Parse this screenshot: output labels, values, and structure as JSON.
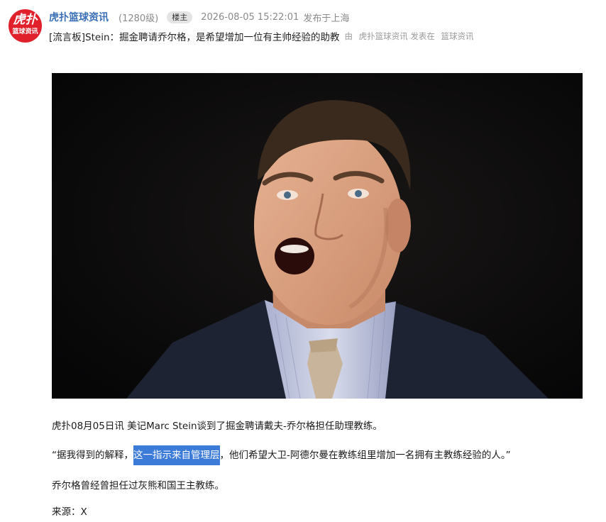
{
  "post": {
    "avatar_line1": "虎扑",
    "avatar_line2": "篮球资讯",
    "author": "虎扑篮球资讯",
    "level": "(1280级)",
    "badge": "楼主",
    "time": "2026-08-05 15:22:01",
    "location": "发布于上海",
    "title": "[流言板]Stein：掘金聘请乔尔格，是希望增加一位有主帅经验的助教",
    "by_prefix": "由",
    "by_author": "虎扑篮球资讯",
    "by_posted": "发表在",
    "by_board": "篮球资讯"
  },
  "body": {
    "para1": "虎扑08月05日讯 美记Marc Stein谈到了掘金聘请戴夫-乔尔格担任助理教练。",
    "para2_before": "“据我得到的解释，",
    "para2_highlight": "这一指示来自管理层",
    "para2_after": "，他们希望大卫-阿德尔曼在教练组里增加一名拥有主教练经验的人。”",
    "para3": "乔尔格曾经曾担任过灰熊和国王主教练。",
    "para4": "来源：X"
  },
  "colors": {
    "author": "#3a6fb5",
    "avatar_bg": "#e0212b",
    "highlight": "#3d7bd9",
    "muted": "#8a8a8a"
  }
}
